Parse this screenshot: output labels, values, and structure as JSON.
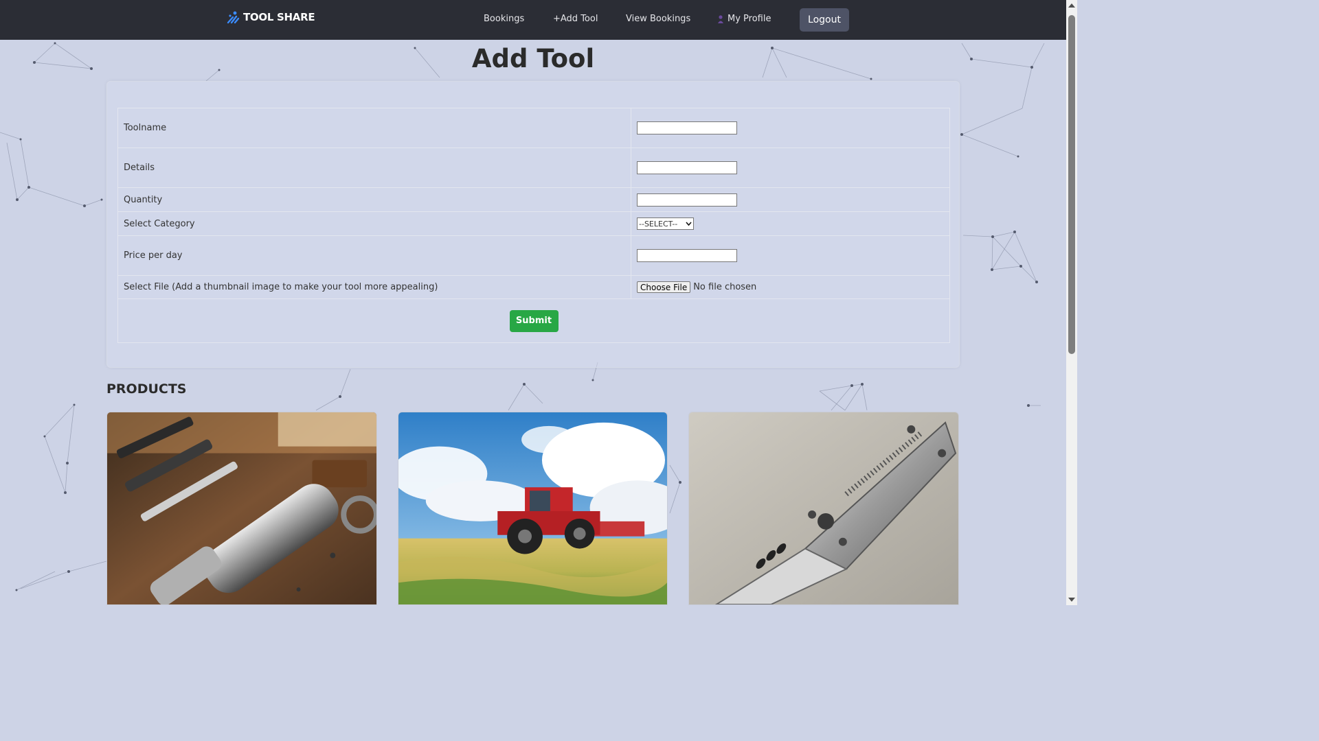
{
  "brand": {
    "name": "TOOL SHARE"
  },
  "nav": {
    "bookings": "Bookings",
    "add_tool": "+Add Tool",
    "view_bookings": "View Bookings",
    "my_profile": "My Profile",
    "logout": "Logout"
  },
  "page": {
    "title": "Add Tool"
  },
  "form": {
    "toolname_label": "Toolname",
    "toolname_value": "",
    "details_label": "Details",
    "details_value": "",
    "quantity_label": "Quantity",
    "quantity_value": "",
    "category_label": "Select Category",
    "category_selected": "--SELECT--",
    "price_label": "Price per day",
    "price_value": "",
    "file_label": "Select File (Add a thumbnail image to make your tool more appealing)",
    "file_button": "Choose File",
    "file_status": "No file chosen",
    "submit": "Submit"
  },
  "products": {
    "heading": "PRODUCTS",
    "items": [
      {
        "image": "tools-on-workbench-image"
      },
      {
        "image": "red-tractor-in-field-image"
      },
      {
        "image": "folding-knife-image"
      }
    ]
  },
  "colors": {
    "navbar": "#2b2d35",
    "background": "#cdd3e6",
    "submit": "#28a745",
    "logout": "#4e5366"
  }
}
